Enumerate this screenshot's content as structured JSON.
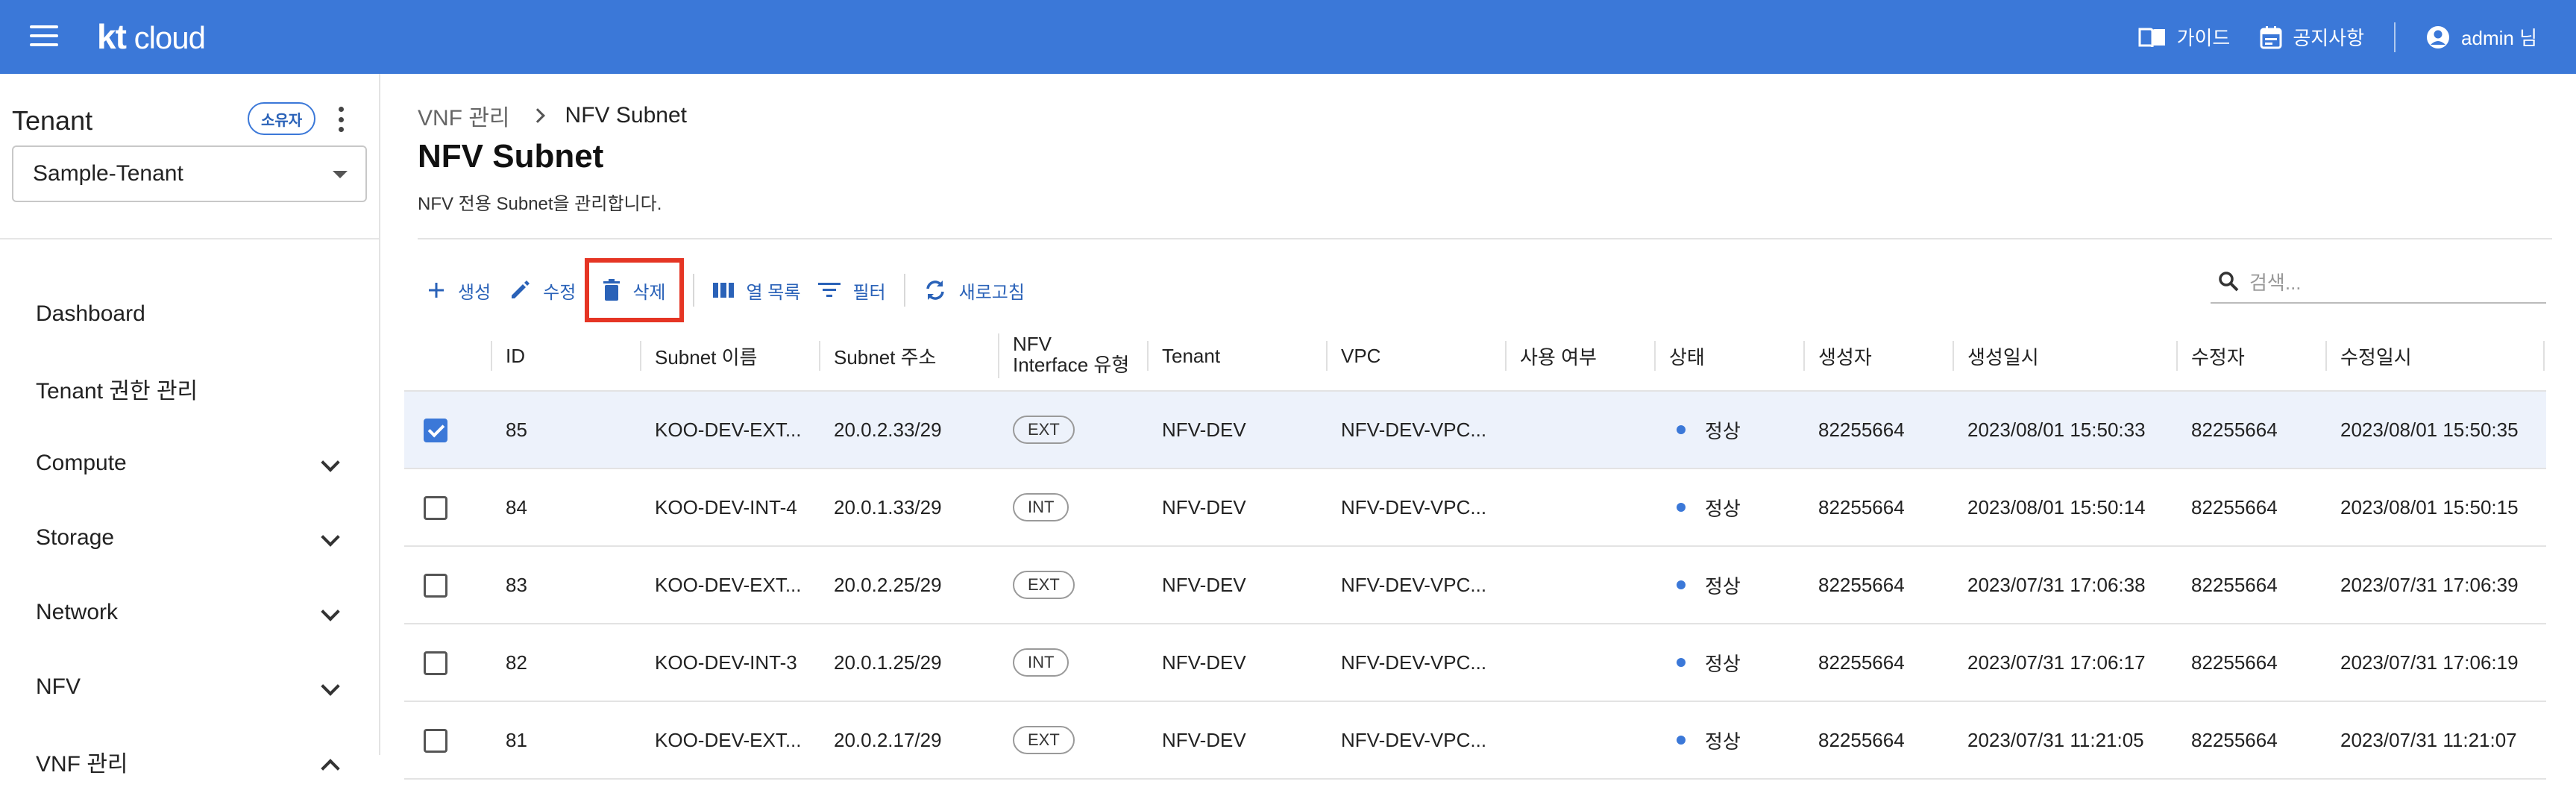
{
  "header": {
    "brand_bold": "kt",
    "brand_rest": " cloud",
    "guide_label": "가이드",
    "notice_label": "공지사항",
    "user_label": "admin 님"
  },
  "sidebar": {
    "tenant_label": "Tenant",
    "owner_badge": "소유자",
    "tenant_selected": "Sample-Tenant",
    "items": [
      {
        "label": "Dashboard",
        "chevron": "none"
      },
      {
        "label": "Tenant 권한 관리",
        "chevron": "none"
      },
      {
        "label": "Compute",
        "chevron": "down"
      },
      {
        "label": "Storage",
        "chevron": "down"
      },
      {
        "label": "Network",
        "chevron": "down"
      },
      {
        "label": "NFV",
        "chevron": "down"
      },
      {
        "label": "VNF 관리",
        "chevron": "up"
      }
    ]
  },
  "main": {
    "breadcrumb_parent": "VNF 관리",
    "breadcrumb_current": "NFV Subnet",
    "title": "NFV Subnet",
    "description": "NFV 전용 Subnet을 관리합니다.",
    "toolbar": {
      "create_label": "생성",
      "edit_label": "수정",
      "delete_label": "삭제",
      "columns_label": "열 목록",
      "filter_label": "필터",
      "refresh_label": "새로고침"
    },
    "search_placeholder": "검색..."
  },
  "table": {
    "columns": [
      "ID",
      "Subnet 이름",
      "Subnet 주소",
      "NFV Interface 유형",
      "Tenant",
      "VPC",
      "사용 여부",
      "상태",
      "생성자",
      "생성일시",
      "수정자",
      "수정일시"
    ],
    "rows": [
      {
        "selected": true,
        "id": "85",
        "name": "KOO-DEV-EXT...",
        "addr": "20.0.2.33/29",
        "type": "EXT",
        "tenant": "NFV-DEV",
        "vpc": "NFV-DEV-VPC...",
        "use": "",
        "status": "정상",
        "creator": "82255664",
        "created": "2023/08/01 15:50:33",
        "modifier": "82255664",
        "modified": "2023/08/01 15:50:35"
      },
      {
        "selected": false,
        "id": "84",
        "name": "KOO-DEV-INT-4",
        "addr": "20.0.1.33/29",
        "type": "INT",
        "tenant": "NFV-DEV",
        "vpc": "NFV-DEV-VPC...",
        "use": "",
        "status": "정상",
        "creator": "82255664",
        "created": "2023/08/01 15:50:14",
        "modifier": "82255664",
        "modified": "2023/08/01 15:50:15"
      },
      {
        "selected": false,
        "id": "83",
        "name": "KOO-DEV-EXT...",
        "addr": "20.0.2.25/29",
        "type": "EXT",
        "tenant": "NFV-DEV",
        "vpc": "NFV-DEV-VPC...",
        "use": "",
        "status": "정상",
        "creator": "82255664",
        "created": "2023/07/31 17:06:38",
        "modifier": "82255664",
        "modified": "2023/07/31 17:06:39"
      },
      {
        "selected": false,
        "id": "82",
        "name": "KOO-DEV-INT-3",
        "addr": "20.0.1.25/29",
        "type": "INT",
        "tenant": "NFV-DEV",
        "vpc": "NFV-DEV-VPC...",
        "use": "",
        "status": "정상",
        "creator": "82255664",
        "created": "2023/07/31 17:06:17",
        "modifier": "82255664",
        "modified": "2023/07/31 17:06:19"
      },
      {
        "selected": false,
        "id": "81",
        "name": "KOO-DEV-EXT...",
        "addr": "20.0.2.17/29",
        "type": "EXT",
        "tenant": "NFV-DEV",
        "vpc": "NFV-DEV-VPC...",
        "use": "",
        "status": "정상",
        "creator": "82255664",
        "created": "2023/07/31 11:21:05",
        "modifier": "82255664",
        "modified": "2023/07/31 11:21:07"
      }
    ]
  },
  "colors": {
    "brand": "#3b78d8",
    "highlight": "#e53524",
    "link": "#2a62b8"
  }
}
